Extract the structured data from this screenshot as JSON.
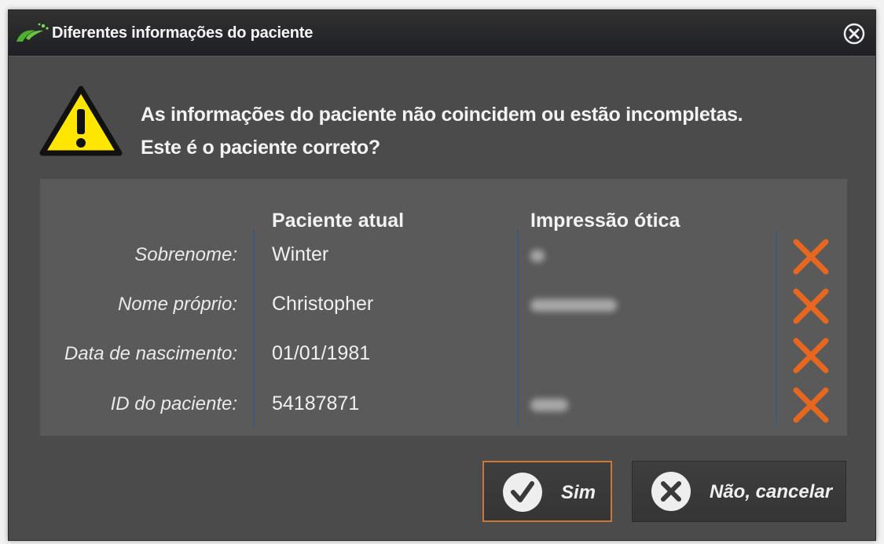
{
  "dialog": {
    "title": "Diferentes informações do paciente",
    "message_line1": "As informações do paciente não coincidem ou estão incompletas.",
    "message_line2": "Este é o paciente correto?"
  },
  "table": {
    "col_current": "Paciente atual",
    "col_optical": "Impressão ótica",
    "rows": [
      {
        "label": "Sobrenome:",
        "current": "Winter"
      },
      {
        "label": "Nome próprio:",
        "current": "Christopher"
      },
      {
        "label": "Data de nascimento:",
        "current": "01/01/1981"
      },
      {
        "label": "ID do paciente:",
        "current": "54187871"
      }
    ]
  },
  "buttons": {
    "yes_label": "Sim",
    "no_label": "Não, cancelar"
  },
  "colors": {
    "mismatch": "#e8671e",
    "warning": "#ffe600",
    "focus_border": "#c8783a",
    "logo": "#4caf30"
  },
  "icons": {
    "logo": "leaf-logo-icon",
    "close": "close-circle-icon",
    "warning": "warning-triangle-icon",
    "mismatch": "x-mark-icon",
    "yes": "check-circle-icon",
    "no": "x-circle-icon"
  }
}
